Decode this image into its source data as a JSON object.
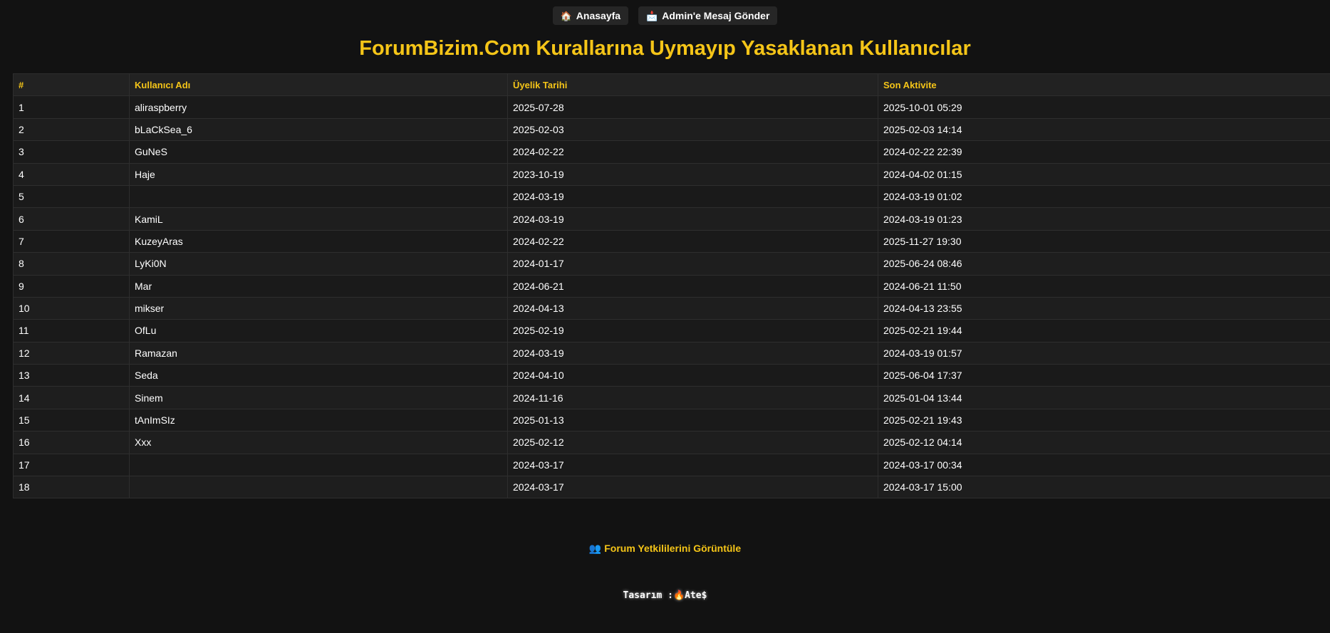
{
  "nav": {
    "home": {
      "icon": "🏠",
      "label": "Anasayfa"
    },
    "message": {
      "icon": "📩",
      "label": "Admin'e Mesaj Gönder"
    }
  },
  "page_title": "ForumBizim.Com Kurallarına Uymayıp Yasaklanan Kullanıcılar",
  "table": {
    "headers": [
      "#",
      "Kullanıcı Adı",
      "Üyelik Tarihi",
      "Son Aktivite"
    ],
    "rows": [
      [
        "1",
        "aliraspberry",
        "2025-07-28",
        "2025-10-01 05:29"
      ],
      [
        "2",
        "bLaCkSea_6",
        "2025-02-03",
        "2025-02-03 14:14"
      ],
      [
        "3",
        "GuNeS",
        "2024-02-22",
        "2024-02-22 22:39"
      ],
      [
        "4",
        "Haje",
        "2023-10-19",
        "2024-04-02 01:15"
      ],
      [
        "5",
        "",
        "2024-03-19",
        "2024-03-19 01:02"
      ],
      [
        "6",
        "KamiL",
        "2024-03-19",
        "2024-03-19 01:23"
      ],
      [
        "7",
        "KuzeyAras",
        "2024-02-22",
        "2025-11-27 19:30"
      ],
      [
        "8",
        "LyKi0N",
        "2024-01-17",
        "2025-06-24 08:46"
      ],
      [
        "9",
        "Mar",
        "2024-06-21",
        "2024-06-21 11:50"
      ],
      [
        "10",
        "mikser",
        "2024-04-13",
        "2024-04-13 23:55"
      ],
      [
        "11",
        "OfLu",
        "2025-02-19",
        "2025-02-21 19:44"
      ],
      [
        "12",
        "Ramazan",
        "2024-03-19",
        "2024-03-19 01:57"
      ],
      [
        "13",
        "Seda",
        "2024-04-10",
        "2025-06-04 17:37"
      ],
      [
        "14",
        "Sinem",
        "2024-11-16",
        "2025-01-04 13:44"
      ],
      [
        "15",
        "tAnImSIz",
        "2025-01-13",
        "2025-02-21 19:43"
      ],
      [
        "16",
        "Xxx",
        "2025-02-12",
        "2025-02-12 04:14"
      ],
      [
        "17",
        "",
        "2024-03-17",
        "2024-03-17 00:34"
      ],
      [
        "18",
        "",
        "2024-03-17",
        "2024-03-17 15:00"
      ]
    ]
  },
  "staff_link": {
    "icon": "👥",
    "label": "Forum Yetkililerini Görüntüle"
  },
  "credit": {
    "prefix": "Tasarım :",
    "icon": "🔥",
    "name": "Ate$"
  },
  "colors": {
    "accent": "#f5c518",
    "background": "#121212",
    "button_bg": "#262626"
  }
}
